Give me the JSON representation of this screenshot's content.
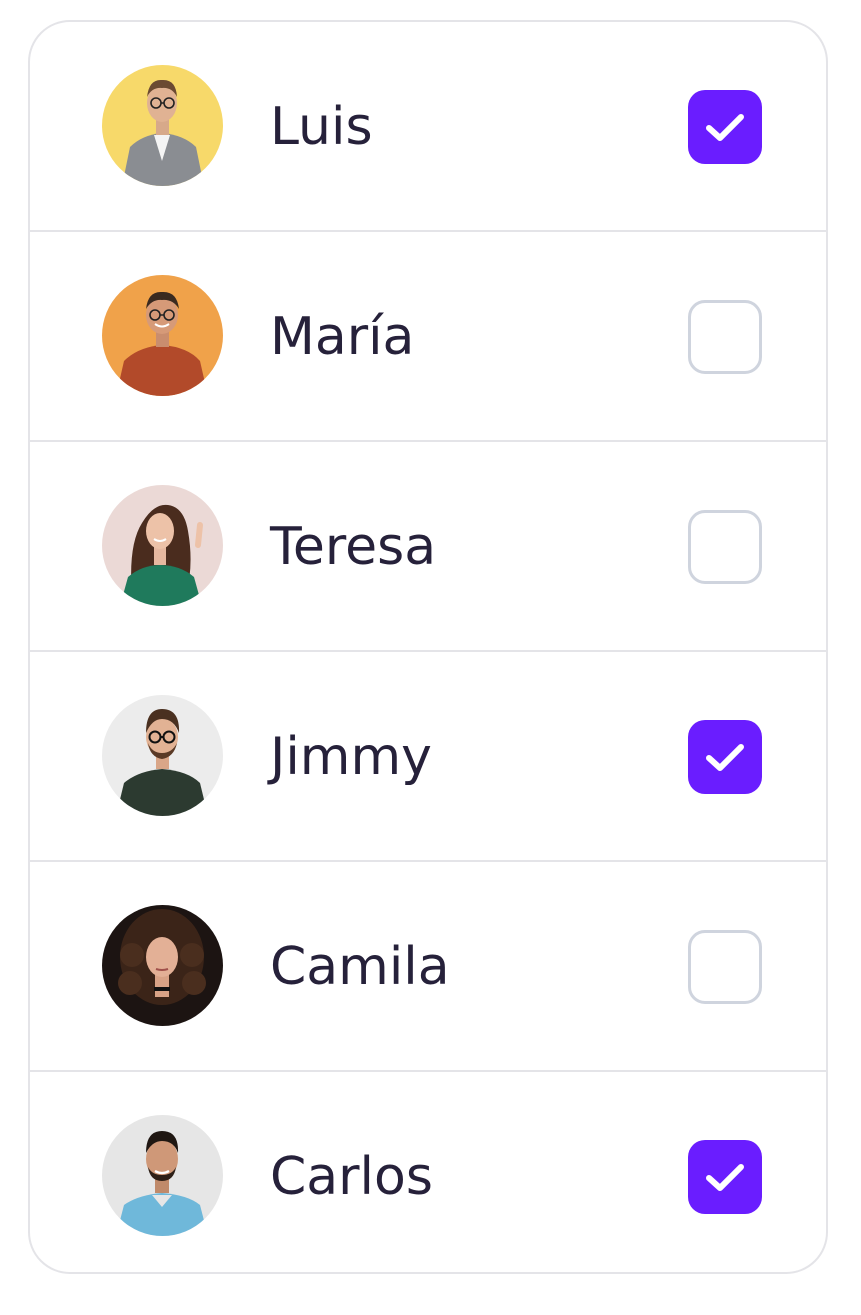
{
  "accent_color": "#6a1dff",
  "people": [
    {
      "name": "Luis",
      "checked": true,
      "avatar_bg": "#f7d96a"
    },
    {
      "name": "María",
      "checked": false,
      "avatar_bg": "#f0a24a"
    },
    {
      "name": "Teresa",
      "checked": false,
      "avatar_bg": "#ebd9d6"
    },
    {
      "name": "Jimmy",
      "checked": true,
      "avatar_bg": "#ececec"
    },
    {
      "name": "Camila",
      "checked": false,
      "avatar_bg": "#1c1412"
    },
    {
      "name": "Carlos",
      "checked": true,
      "avatar_bg": "#e6e6e6"
    }
  ]
}
